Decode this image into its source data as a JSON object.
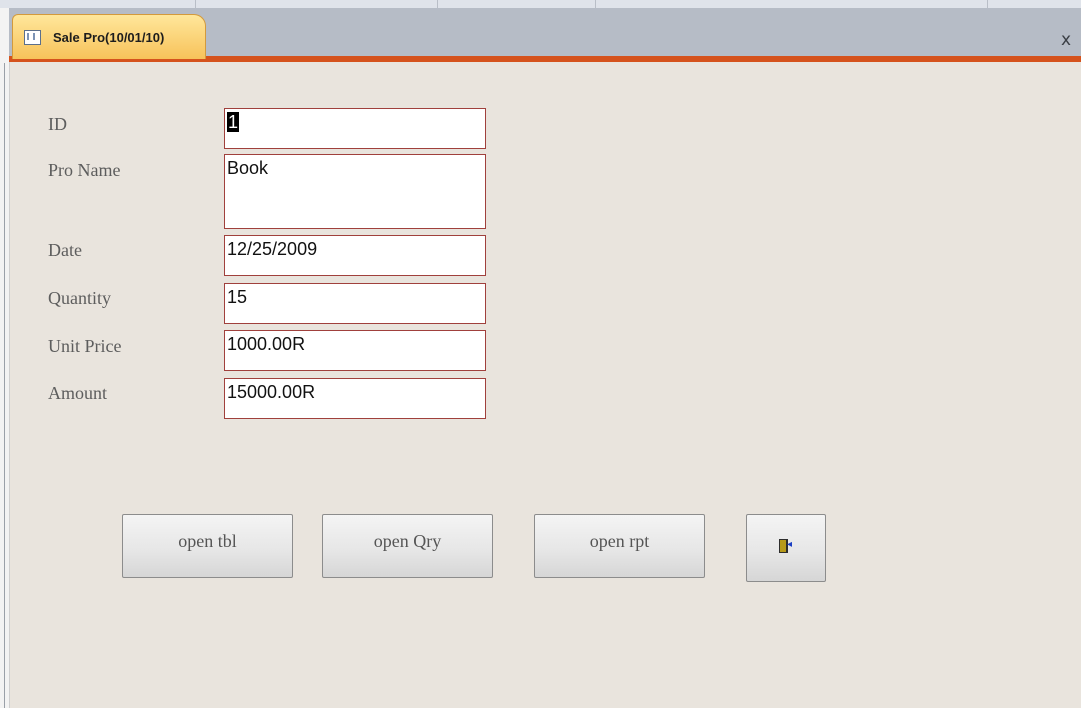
{
  "tab": {
    "title": "Sale Pro(10/01/10)",
    "icon": "form-icon",
    "close_label": "x"
  },
  "form": {
    "fields": [
      {
        "label": "ID",
        "value": "1"
      },
      {
        "label": "Pro Name",
        "value": "Book"
      },
      {
        "label": "Date",
        "value": "12/25/2009"
      },
      {
        "label": "Quantity",
        "value": "15"
      },
      {
        "label": "Unit Price",
        "value": "1000.00R"
      },
      {
        "label": "Amount",
        "value": "15000.00R"
      }
    ]
  },
  "buttons": {
    "open_tbl": "open tbl",
    "open_qry": "open Qry",
    "open_rpt": "open rpt",
    "exit_icon": "exit-door-icon"
  },
  "colors": {
    "accent": "#d5521c",
    "field_border": "#a0403c",
    "background": "#e9e4dd",
    "tab_active": "#f7c25a"
  }
}
